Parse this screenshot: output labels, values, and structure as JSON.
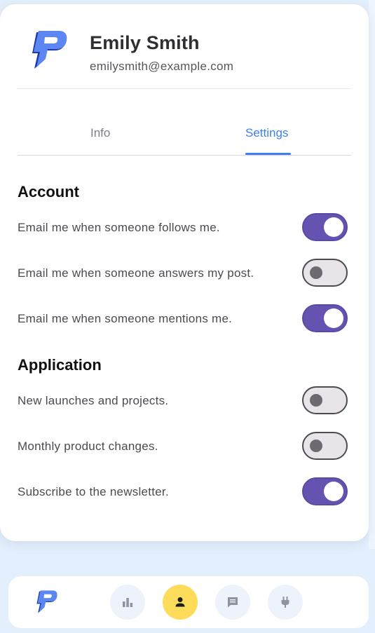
{
  "profile": {
    "name": "Emily Smith",
    "email": "emilysmith@example.com"
  },
  "tabs": [
    {
      "label": "Info",
      "active": false
    },
    {
      "label": "Settings",
      "active": true
    }
  ],
  "sections": {
    "account": {
      "title": "Account",
      "items": [
        {
          "label": "Email me when someone follows me.",
          "enabled": true
        },
        {
          "label": "Email me when someone answers my post.",
          "enabled": false
        },
        {
          "label": "Email me when someone mentions me.",
          "enabled": true
        }
      ]
    },
    "application": {
      "title": "Application",
      "items": [
        {
          "label": "New launches and projects.",
          "enabled": false
        },
        {
          "label": "Monthly product changes.",
          "enabled": false
        },
        {
          "label": "Subscribe to the newsletter.",
          "enabled": true
        }
      ]
    }
  },
  "bottom_nav": {
    "items": [
      {
        "icon": "bar-chart-icon",
        "active": false
      },
      {
        "icon": "user-icon",
        "active": true
      },
      {
        "icon": "chat-icon",
        "active": false
      },
      {
        "icon": "plug-icon",
        "active": false
      }
    ]
  },
  "colors": {
    "accent": "#3d7ff0",
    "toggle_on": "#6652b0",
    "nav_active": "#fddc5c",
    "background": "#e3effc"
  }
}
